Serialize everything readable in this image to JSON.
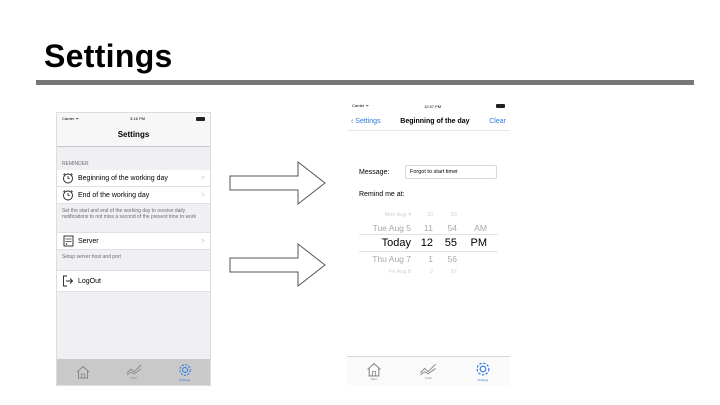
{
  "slide": {
    "title": "Settings"
  },
  "phone1": {
    "status": {
      "carrier": "Carrier ᯤ",
      "time": "3:16 PM"
    },
    "nav_title": "Settings",
    "reminder_header": "REMINDER",
    "rows": [
      {
        "label": "Beginning of the working day",
        "icon": "alarm-clock-icon"
      },
      {
        "label": "End of the working day",
        "icon": "alarm-clock-icon"
      }
    ],
    "reminder_footer": "Set the start and end of the working day to receive daily notifications to not miss a second of the present time to work",
    "server_label": "Server",
    "server_footer": "Setup server host and port",
    "logout_label": "LogOut",
    "tabs": {
      "main": "",
      "chart": "Chart",
      "settings": "Settings"
    },
    "accent": "#2a7ae2"
  },
  "phone2": {
    "status": {
      "carrier": "Carrier ᯤ",
      "time": "12:57 PM"
    },
    "back_label": "Settings",
    "nav_title": "Beginning of the day",
    "clear_label": "Clear",
    "message_label": "Message:",
    "message_value": "Forgot to start timer",
    "remind_label": "Remind me at:",
    "picker": {
      "rows": [
        [
          "Mon Aug 4",
          "10",
          "53",
          ""
        ],
        [
          "Tue Aug 5",
          "11",
          "54",
          "AM"
        ],
        [
          "Today",
          "12",
          "55",
          "PM"
        ],
        [
          "Thu Aug 7",
          "1",
          "56",
          ""
        ],
        [
          "Fri Aug 8",
          "2",
          "57",
          ""
        ]
      ],
      "selected_index": 2
    },
    "tabs": {
      "main": "Main",
      "chart": "Chart",
      "settings": "Settings"
    }
  }
}
